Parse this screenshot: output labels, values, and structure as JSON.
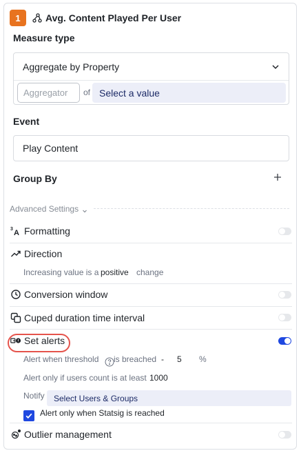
{
  "metric": {
    "number": "1",
    "icon": "metric-icon",
    "title": "Avg. Content Played Per User"
  },
  "measure_type": {
    "label": "Measure type",
    "selected": "Aggregate by Property",
    "aggregator_placeholder": "Aggregator",
    "of_text": "of",
    "value_placeholder": "Select a value"
  },
  "event": {
    "label": "Event",
    "value": "Play Content"
  },
  "group_by": {
    "label": "Group By",
    "add_icon": "plus-icon"
  },
  "advanced": {
    "label": "Advanced Settings"
  },
  "settings": {
    "formatting": {
      "label": "Formatting",
      "icon": "superscript-a-icon",
      "enabled": false
    },
    "direction": {
      "label": "Direction",
      "icon": "trend-up-icon",
      "prefix": "Increasing value is a",
      "value": "positive",
      "suffix": "change"
    },
    "conversion_window": {
      "label": "Conversion window",
      "icon": "clock-icon",
      "enabled": false
    },
    "cuped": {
      "label": "Cuped duration time interval",
      "icon": "copy-icon",
      "enabled": false
    },
    "set_alerts": {
      "label": "Set alerts",
      "icon": "alert-icon",
      "enabled": true,
      "threshold_label": "Alert when threshold",
      "threshold_suffix": "is breached",
      "threshold_dash": "-",
      "threshold_value": "5",
      "threshold_unit": "%",
      "users_label": "Alert only if users count is at least",
      "users_value": "1000",
      "notify_label": "Notify",
      "notify_placeholder": "Select Users & Groups",
      "statsig_label": "Alert only when Statsig is reached",
      "statsig_checked": true
    },
    "outlier": {
      "label": "Outlier management",
      "icon": "outlier-icon",
      "enabled": false
    }
  },
  "colors": {
    "badge": "#e8731f",
    "accent": "#1f48e0",
    "highlight_ring": "#e5534b",
    "select_bg": "#eceef8"
  }
}
